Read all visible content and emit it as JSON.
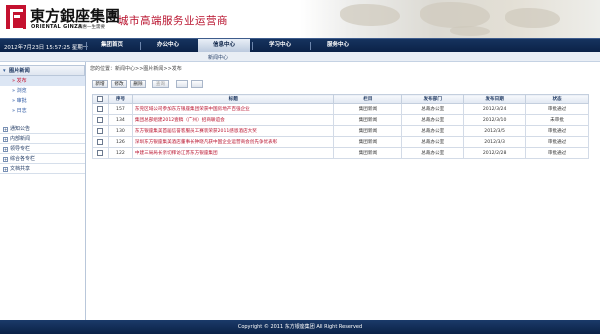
{
  "brand": {
    "name_cn": "東方銀座集團",
    "name_en": "ORIENTAL GINZA",
    "sub": "澜惠一生需要",
    "slogan": "城市高端服务业运营商"
  },
  "datetime": "2012年7月23日 15:57:25 星期一",
  "nav": [
    "集团首页",
    "办公中心",
    "信息中心",
    "学习中心",
    "服务中心"
  ],
  "nav_active_index": 2,
  "subnav": "新闻中心",
  "sidebar": {
    "section": "图片新闻",
    "items": [
      "发布",
      "浏览",
      "审批",
      "日志"
    ],
    "active_index": 0,
    "groups": [
      "通知公告",
      "内部新闻",
      "领导专栏",
      "综合各专栏",
      "文档共享"
    ]
  },
  "breadcrumb": "您的位置：新闻中心>>图片新闻>>发布",
  "toolbar": {
    "buttons": [
      "新增",
      "修改",
      "删除",
      "查询",
      "",
      ""
    ],
    "disabled": [
      false,
      false,
      false,
      true,
      true,
      true
    ]
  },
  "table": {
    "headers": [
      "",
      "序号",
      "标题",
      "栏目",
      "发布部门",
      "发布日期",
      "状态"
    ],
    "rows": [
      [
        "",
        "157",
        "东莞区域公司参加东方银座集团荣获中国房地产百强企业",
        "集团新闻",
        "总裁办公室",
        "2012/3/24",
        "审批通过"
      ],
      [
        "",
        "134",
        "集团总部组建2012壹稿（广州）招商联谊会",
        "集团新闻",
        "总裁办公室",
        "2012/3/10",
        "未审批"
      ],
      [
        "",
        "130",
        "东方银座集美首届信誉客服员工赛装荣获2011感恩酒店大奖",
        "集团新闻",
        "总裁办公室",
        "2012/3/5",
        "审批通过"
      ],
      [
        "",
        "126",
        "深圳东方银座集美酒店董事长钟晓凡获中国企业运营商会创先争优表彰",
        "集团新闻",
        "总裁办公室",
        "2012/3/3",
        "审批通过"
      ],
      [
        "",
        "122",
        "中建三局局长亲切拜访江苏东方银座集团",
        "集团新闻",
        "总裁办公室",
        "2012/2/28",
        "审批通过"
      ]
    ]
  },
  "footer": "Copyright © 2011 东方银座集团 All Right Reserved",
  "colors": {
    "brand_red": "#c4112f",
    "nav_blue": "#0b2247",
    "link_blue": "#2a56a2"
  },
  "icons": {
    "logo": "oriental-ginza-logo"
  }
}
